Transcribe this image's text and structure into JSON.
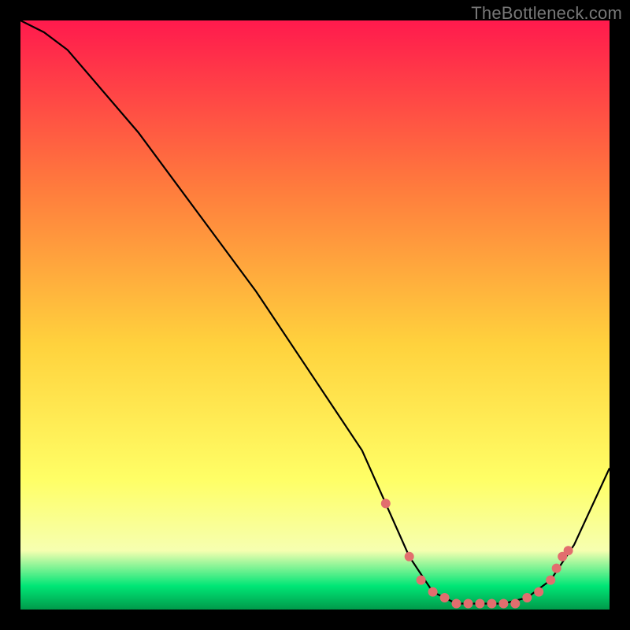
{
  "watermark": "TheBottleneck.com",
  "colors": {
    "bg": "#000000",
    "grad_top": "#ff1a4d",
    "grad_upper_mid": "#ff7a3d",
    "grad_mid": "#ffd23d",
    "grad_lower_mid": "#ffff66",
    "grad_lower": "#f6ffb0",
    "grad_green": "#00e676",
    "grad_bottom": "#009a4a",
    "curve": "#000000",
    "marker": "#e26e6e"
  },
  "chart_data": {
    "type": "line",
    "title": "",
    "xlabel": "",
    "ylabel": "",
    "xlim": [
      0,
      100
    ],
    "ylim": [
      0,
      100
    ],
    "series": [
      {
        "name": "bottleneck-curve",
        "x": [
          0,
          4,
          8,
          20,
          40,
          58,
          62,
          66,
          70,
          74,
          78,
          82,
          86,
          90,
          94,
          100
        ],
        "y": [
          100,
          98,
          95,
          81,
          54,
          27,
          18,
          9,
          3,
          1,
          1,
          1,
          2,
          5,
          11,
          24
        ]
      }
    ],
    "markers": {
      "name": "highlighted-range",
      "x": [
        62,
        66,
        68,
        70,
        72,
        74,
        76,
        78,
        80,
        82,
        84,
        86,
        88,
        90,
        91,
        92,
        93
      ],
      "y": [
        18,
        9,
        5,
        3,
        2,
        1,
        1,
        1,
        1,
        1,
        1,
        2,
        3,
        5,
        7,
        9,
        10
      ]
    }
  }
}
